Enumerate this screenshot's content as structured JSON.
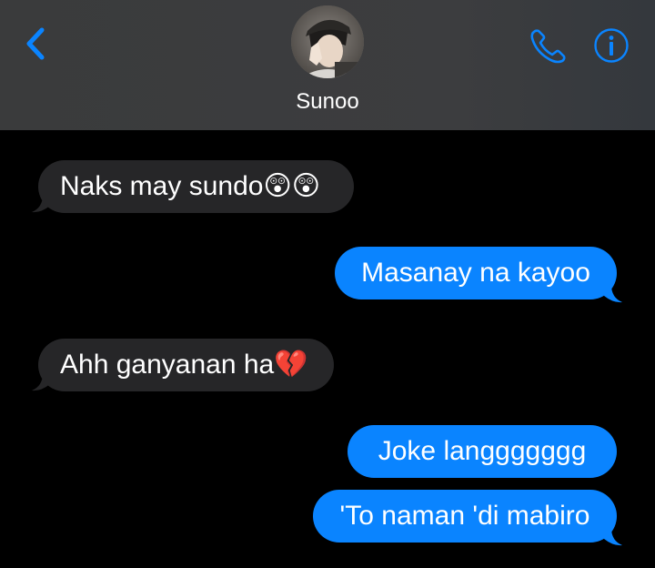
{
  "header": {
    "contact_name": "Sunoo",
    "back_icon": "chevron-left-icon",
    "call_icon": "phone-icon",
    "info_icon": "info-icon",
    "accent_color": "#0a84ff"
  },
  "messages": [
    {
      "direction": "incoming",
      "text": "Naks may sundo",
      "emoji": "😲😲"
    },
    {
      "direction": "outgoing",
      "text": "Masanay na kayoo"
    },
    {
      "direction": "incoming",
      "text": "Ahh ganyanan ha",
      "emoji": "💔"
    },
    {
      "direction": "outgoing",
      "text": "Joke langgggggg"
    },
    {
      "direction": "outgoing",
      "text": "'To naman 'di mabiro"
    }
  ],
  "colors": {
    "incoming_bubble": "#262628",
    "outgoing_bubble": "#0a84ff",
    "background": "#000000",
    "header_bg": "#3b3c3e"
  }
}
